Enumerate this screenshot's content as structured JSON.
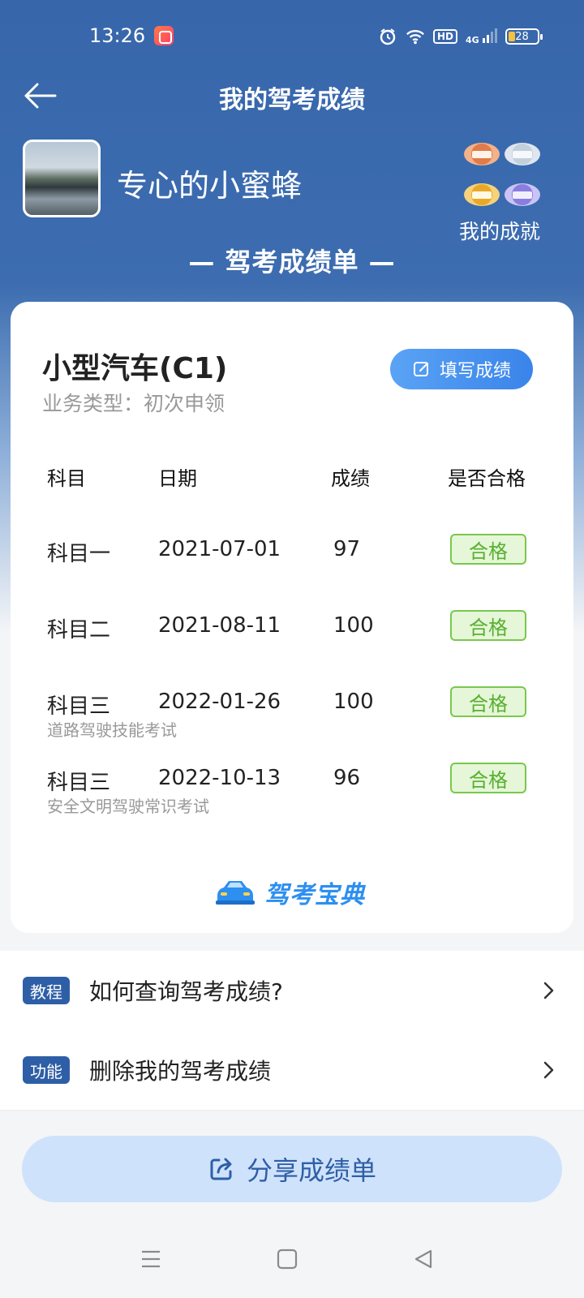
{
  "status_bar": {
    "time": "13:26",
    "network": "4G",
    "hd": "HD",
    "battery": "28"
  },
  "header": {
    "title": "我的驾考成绩"
  },
  "profile": {
    "username": "专心的小蜜蜂",
    "achievements_label": "我的成就"
  },
  "report_title": "— 驾考成绩单 —",
  "card": {
    "license": "小型汽车(C1)",
    "business_type": "业务类型：初次申领",
    "fill_button": "填写成绩",
    "columns": [
      "科目",
      "日期",
      "成绩",
      "是否合格"
    ],
    "rows": [
      {
        "subject": "科目一",
        "date": "2021-07-01",
        "score": "97",
        "result": "合格",
        "note": ""
      },
      {
        "subject": "科目二",
        "date": "2021-08-11",
        "score": "100",
        "result": "合格",
        "note": ""
      },
      {
        "subject": "科目三",
        "date": "2022-01-26",
        "score": "100",
        "result": "合格",
        "note": "道路驾驶技能考试"
      },
      {
        "subject": "科目三",
        "date": "2022-10-13",
        "score": "96",
        "result": "合格",
        "note": "安全文明驾驶常识考试"
      }
    ],
    "brand": "驾考宝典"
  },
  "list": [
    {
      "tag": "教程",
      "label": "如何查询驾考成绩?"
    },
    {
      "tag": "功能",
      "label": "删除我的驾考成绩"
    }
  ],
  "share_button": "分享成绩单",
  "colors": {
    "header_blue": "#3766ab",
    "pass_green": "#58b030",
    "accent_blue": "#3a84ea"
  }
}
